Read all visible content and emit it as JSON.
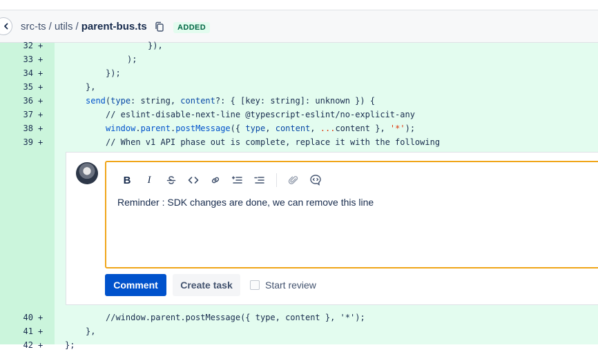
{
  "header": {
    "path": [
      "src-ts",
      "utils"
    ],
    "separator": "/",
    "file_name": "parent-bus.ts",
    "badge": "ADDED",
    "icons": {
      "collapse": "chevron-left-icon",
      "copy": "copy-icon"
    }
  },
  "diff_lines_top": [
    {
      "num": "32",
      "marker": "+"
    },
    {
      "num": "33",
      "marker": "+"
    },
    {
      "num": "34",
      "marker": "+"
    },
    {
      "num": "35",
      "marker": "+"
    },
    {
      "num": "36",
      "marker": "+"
    },
    {
      "num": "37",
      "marker": "+"
    },
    {
      "num": "38",
      "marker": "+"
    },
    {
      "num": "39",
      "marker": "+"
    }
  ],
  "code": {
    "l32": "}),",
    "l33": ");",
    "l34": "});",
    "l35": "},",
    "l36_name": "send",
    "l36_p1": "type",
    "l36_t1": ": string, ",
    "l36_p2": "content",
    "l36_rest": "?: { [key: string]: unknown }) {",
    "l37": "// eslint-disable-next-line @typescript-eslint/no-explicit-any",
    "l38_a": "window",
    "l38_b": ".",
    "l38_c": "parent",
    "l38_d": ".",
    "l38_e": "postMessage",
    "l38_f": "({ ",
    "l38_g": "type",
    "l38_h": ", ",
    "l38_i": "content",
    "l38_j": ", ",
    "l38_k": "...",
    "l38_l": "content }, ",
    "l38_m": "'*'",
    "l38_n": ");",
    "l39": "// When v1 API phase out is complete, replace it with the following",
    "l40": "//window.parent.postMessage({ type, content }, '*');",
    "l41": "},",
    "l42": "};"
  },
  "diff_lines_bottom": [
    {
      "num": "40",
      "marker": "+"
    },
    {
      "num": "41",
      "marker": "+"
    },
    {
      "num": "42",
      "marker": "+"
    }
  ],
  "comment": {
    "text": "Reminder : SDK changes are done, we can remove this line",
    "submit_label": "Comment",
    "task_label": "Create task",
    "review_label": "Start review",
    "toolbar": [
      "bold-icon",
      "italic-icon",
      "strikethrough-icon",
      "code-icon",
      "link-icon",
      "bulleted-list-icon",
      "numbered-list-icon",
      "attachment-icon",
      "mention-icon"
    ]
  },
  "colors": {
    "added_bg": "#e3fcef",
    "gutter_bg": "#cbf5dc",
    "focus_border": "#f0a518",
    "primary_button": "#0052cc",
    "badge_text": "#006644"
  }
}
